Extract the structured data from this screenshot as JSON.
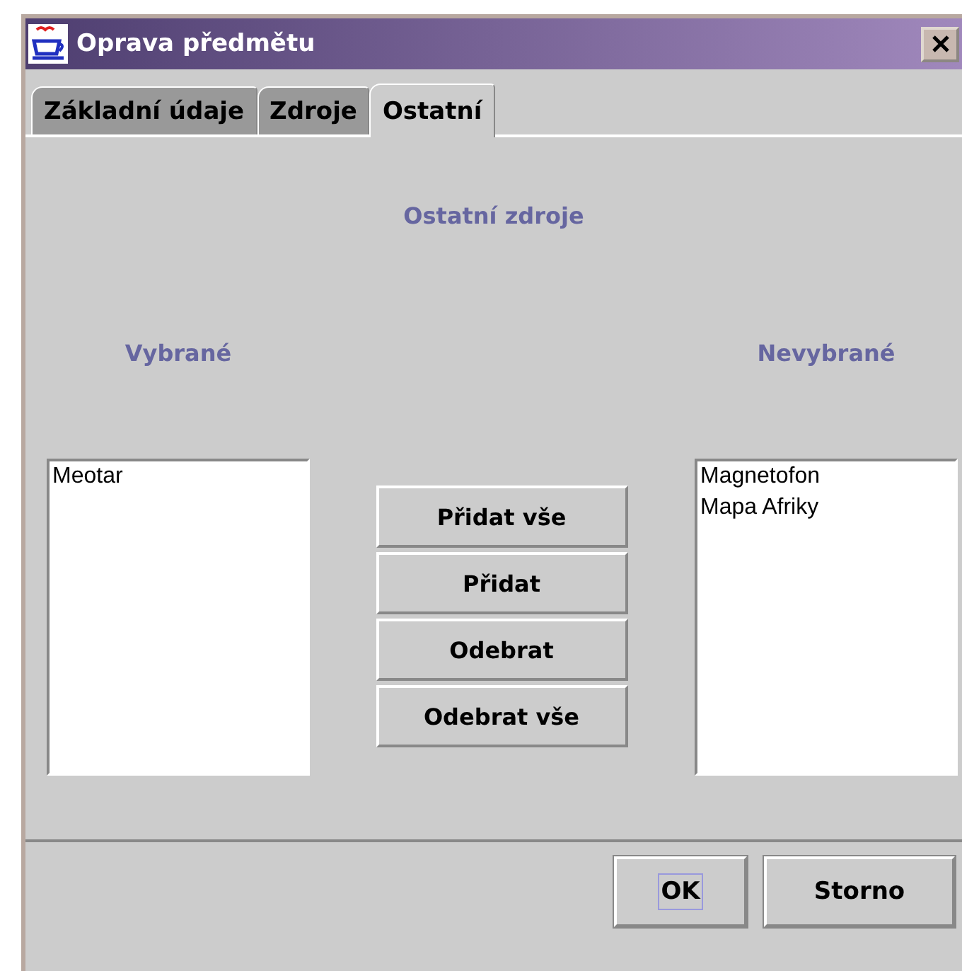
{
  "window": {
    "title": "Oprava předmětu"
  },
  "tabs": [
    {
      "label": "Základní údaje",
      "selected": false
    },
    {
      "label": "Zdroje",
      "selected": false
    },
    {
      "label": "Ostatní",
      "selected": true
    }
  ],
  "heading": "Ostatní zdroje",
  "selected_list": {
    "label": "Vybrané",
    "items": [
      "Meotar"
    ]
  },
  "transfer_buttons": [
    "Přidat vše",
    "Přidat",
    "Odebrat",
    "Odebrat vše"
  ],
  "unselected_list": {
    "label": "Nevybrané",
    "items": [
      "Magnetofon",
      "Mapa Afriky"
    ]
  },
  "buttons": [
    {
      "label": "OK",
      "focused": true
    },
    {
      "label": "Storno",
      "focused": false
    }
  ]
}
